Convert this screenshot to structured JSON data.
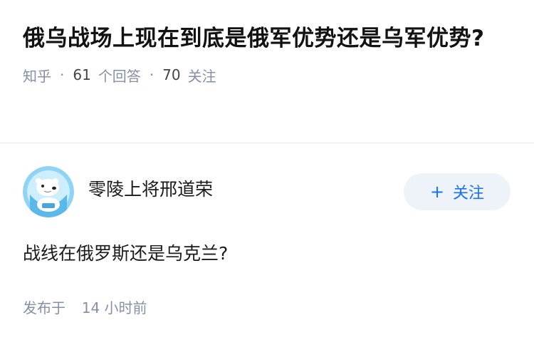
{
  "question": {
    "title": "俄乌战场上现在到底是俄军优势还是乌军优势?",
    "source": "知乎",
    "answer_count": "61",
    "answer_label": "个回答",
    "follower_count": "70",
    "follower_label": "关注"
  },
  "answer": {
    "author_name": "零陵上将邢道荣",
    "avatar_icon": "polar-bear-astronaut-avatar",
    "follow_plus": "+",
    "follow_label": "关注",
    "content": "战线在俄罗斯还是乌克兰?",
    "publish_label": "发布于",
    "publish_time": "14 小时前"
  },
  "colors": {
    "accent": "#1772f6",
    "follow_bg": "#eef3f9",
    "meta_gray": "#8590a6",
    "title": "#121212"
  }
}
